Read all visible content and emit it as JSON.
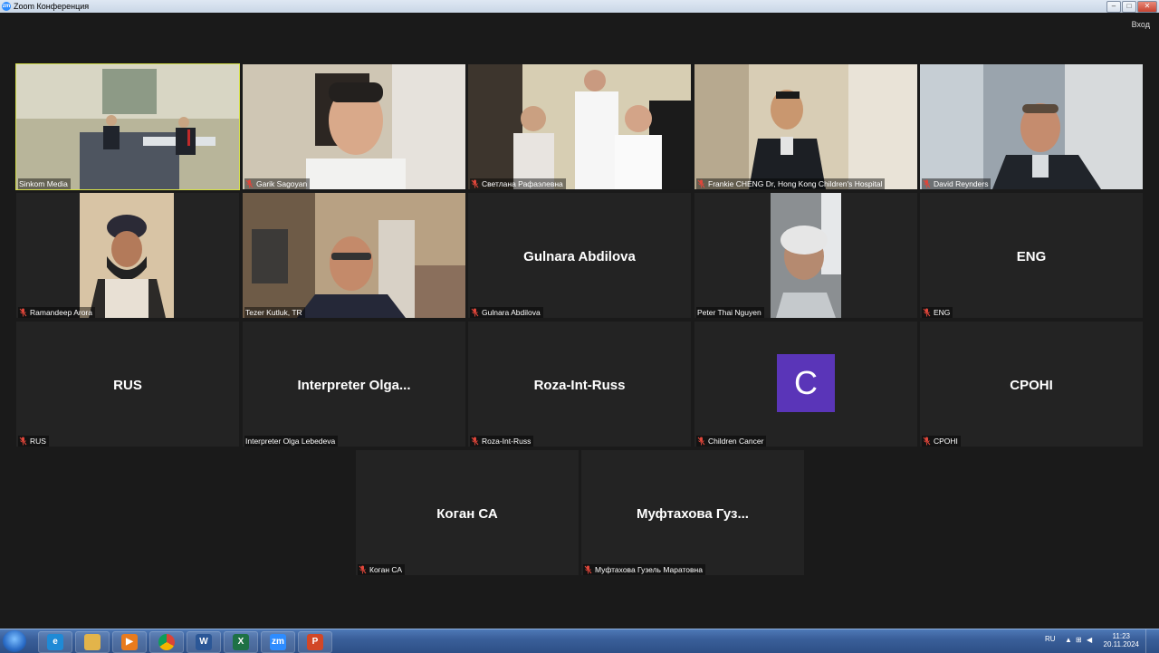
{
  "window": {
    "title": "Zoom Конференция",
    "app_icon": "zm"
  },
  "header": {
    "signin_label": "Вход"
  },
  "participants": [
    {
      "display_name": "",
      "label": "Sinkom Media",
      "muted": false,
      "video": true,
      "active_speaker": true
    },
    {
      "display_name": "",
      "label": "Garik Sagoyan",
      "muted": true,
      "video": true
    },
    {
      "display_name": "",
      "label": "Светлана Рафаэлевна",
      "muted": true,
      "video": true
    },
    {
      "display_name": "",
      "label": "Frankie CHENG Dr, Hong Kong Children's Hospital",
      "muted": true,
      "video": true
    },
    {
      "display_name": "",
      "label": "David Reynders",
      "muted": true,
      "video": true
    },
    {
      "display_name": "",
      "label": "Ramandeep Arora",
      "muted": true,
      "video": true
    },
    {
      "display_name": "",
      "label": "Tezer Kutluk, TR",
      "muted": false,
      "video": true
    },
    {
      "display_name": "Gulnara Abdilova",
      "label": "Gulnara Abdilova",
      "muted": true,
      "video": false
    },
    {
      "display_name": "",
      "label": "Peter Thai Nguyen",
      "muted": false,
      "video": true
    },
    {
      "display_name": "ENG",
      "label": "ENG",
      "muted": true,
      "video": false
    },
    {
      "display_name": "RUS",
      "label": "RUS",
      "muted": true,
      "video": false
    },
    {
      "display_name": "Interpreter  Olga...",
      "label": "Interpreter Olga Lebedeva",
      "muted": false,
      "video": false
    },
    {
      "display_name": "Roza-Int-Russ",
      "label": "Roza-Int-Russ",
      "muted": true,
      "video": false
    },
    {
      "display_name": "",
      "avatar_letter": "C",
      "label": "Children Cancer",
      "muted": true,
      "video": false
    },
    {
      "display_name": "CPOHI",
      "label": "CPOHI",
      "muted": true,
      "video": false
    },
    {
      "display_name": "Коган СА",
      "label": "Коган СА",
      "muted": true,
      "video": false
    },
    {
      "display_name": "Муфтахова  Гуз...",
      "label": "Муфтахова Гузель Маратовна",
      "muted": true,
      "video": false
    }
  ],
  "taskbar": {
    "apps": [
      {
        "icon": "internet-explorer-icon",
        "glyph": "e",
        "color": "#1f8ad6"
      },
      {
        "icon": "file-explorer-icon",
        "glyph": "",
        "color": "#e3b44a"
      },
      {
        "icon": "media-player-icon",
        "glyph": "▶",
        "color": "#e87b1e"
      },
      {
        "icon": "chrome-icon",
        "glyph": "",
        "color": "#db4437"
      },
      {
        "icon": "word-icon",
        "glyph": "W",
        "color": "#2b5797"
      },
      {
        "icon": "excel-icon",
        "glyph": "X",
        "color": "#1e7145"
      },
      {
        "icon": "zoom-icon",
        "glyph": "zm",
        "color": "#2d8cff"
      },
      {
        "icon": "powerpoint-icon",
        "glyph": "P",
        "color": "#d24726"
      }
    ],
    "language": "RU",
    "time": "11:23",
    "date": "20.11.2024"
  },
  "colors": {
    "background": "#1a1a1a",
    "tile": "#232323",
    "active_outline": "#d6e04a",
    "muted_mic": "#e0463a",
    "avatar": "#5a35b8"
  }
}
